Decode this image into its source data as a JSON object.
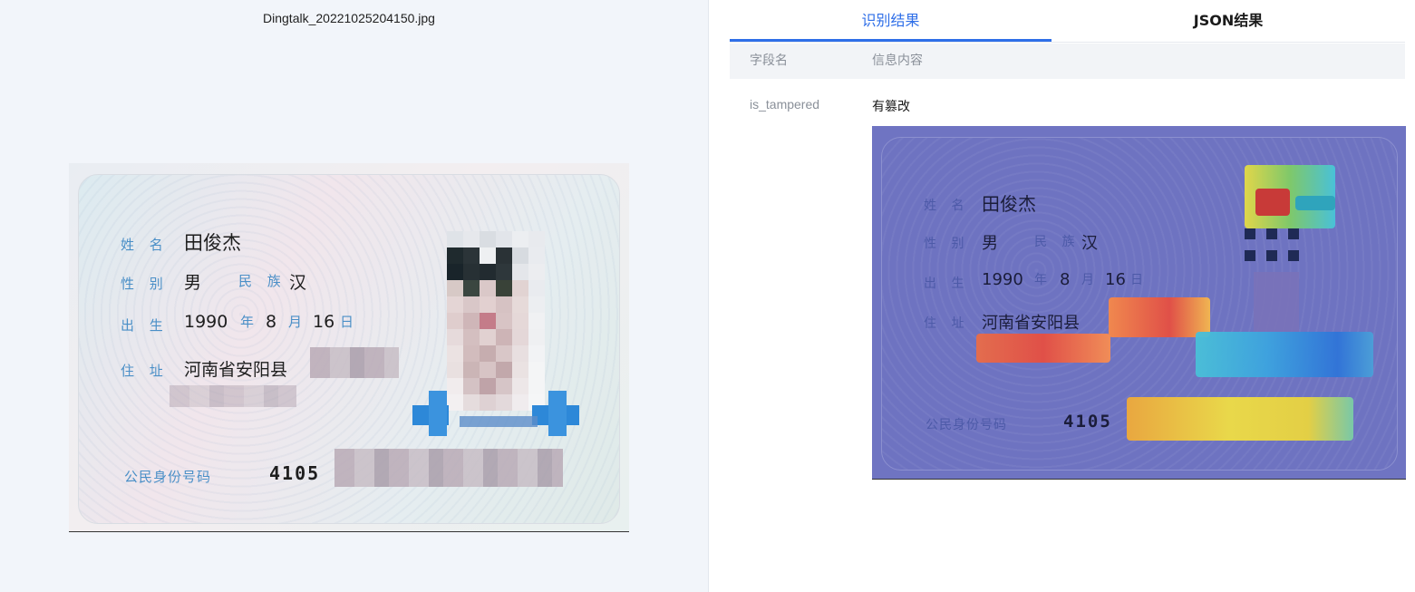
{
  "file": {
    "name": "Dingtalk_20221025204150.jpg"
  },
  "tabs": [
    {
      "label": "识别结果",
      "active": true
    },
    {
      "label": "JSON结果",
      "active": false
    }
  ],
  "table": {
    "headers": [
      "字段名",
      "信息内容"
    ],
    "rows": [
      {
        "key": "is_tampered",
        "value": "有篡改"
      }
    ]
  },
  "card": {
    "name_label": "姓 名",
    "name": "田俊杰",
    "gender_label": "性 别",
    "gender": "男",
    "ethnicity_label": "民 族",
    "ethnicity": "汉",
    "birth_label": "出 生",
    "birth_year": "1990",
    "year_char": "年",
    "birth_month": "8",
    "month_char": "月",
    "birth_day": "16",
    "day_char": "日",
    "address_label": "住 址",
    "address": "河南省安阳县",
    "id_label": "公民身份号码",
    "id_prefix": "4105"
  },
  "colors": {
    "accent": "#2f6fe8",
    "heat_red": "#e5514a",
    "heat_yellow": "#e9d84a",
    "heat_cyan": "#4ec6d6",
    "overlay": "#6e73c1"
  }
}
